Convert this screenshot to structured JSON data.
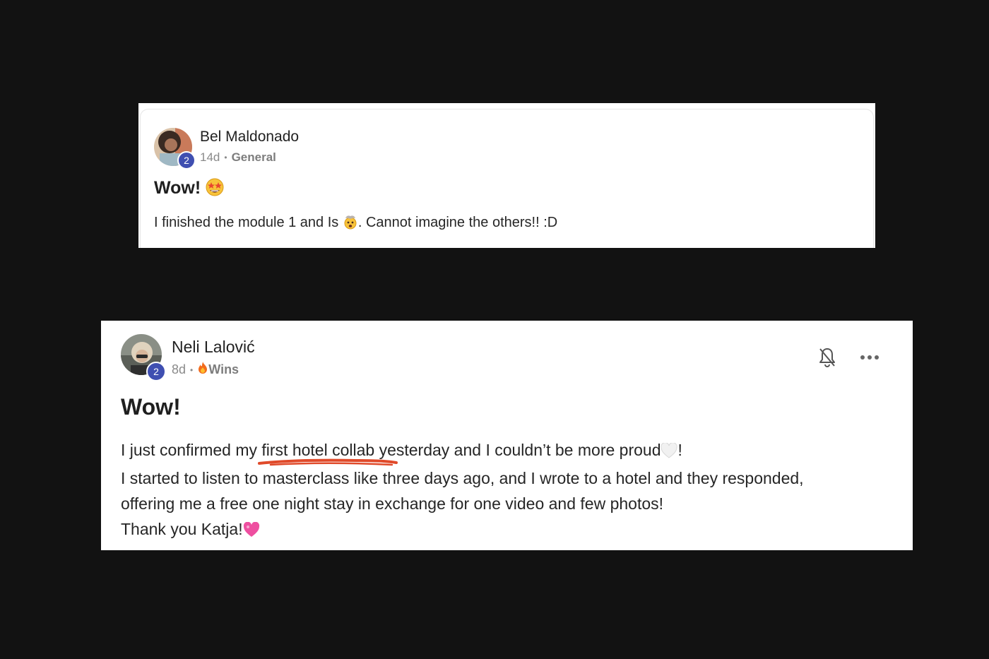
{
  "posts": [
    {
      "author": "Bel Maldonado",
      "level": "2",
      "time": "14d",
      "category": "General",
      "title": "Wow!",
      "body_before": "I finished the module 1 and Is",
      "body_after": ". Cannot imagine the others!! :D"
    },
    {
      "author": "Neli Lalović",
      "level": "2",
      "time": "8d",
      "category": "Wins",
      "title": "Wow!",
      "lines": [
        "I just confirmed my first hotel collab yesterday and I couldn’t be more proud",
        "!",
        "I started to listen to masterclass like three days ago, and I wrote to a hotel and they responded,",
        "offering me a free one night stay in exchange for one video and few photos!",
        "Thank you Katja!"
      ]
    }
  ],
  "colors": {
    "background": "#121212",
    "level_badge": "#3f4fb1",
    "highlight_underline": "#e04a2a"
  },
  "icons": [
    "star-struck-emoji",
    "exploding-head-emoji",
    "fire-emoji",
    "white-heart-emoji",
    "pink-heart-emoji",
    "bell-off-icon",
    "more-options-icon"
  ]
}
